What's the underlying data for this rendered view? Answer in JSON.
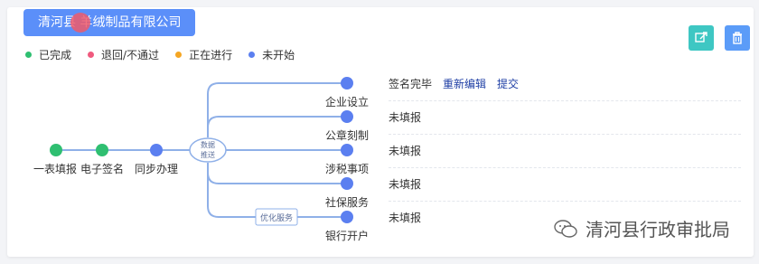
{
  "company": {
    "name": "清河县 羊绒制品有限公司"
  },
  "actions": {
    "share_icon": "share-icon",
    "delete_icon": "trash-icon"
  },
  "legend": [
    {
      "label": "已完成",
      "color": "#2fbf71"
    },
    {
      "label": "退回/不通过",
      "color": "#f05a7e"
    },
    {
      "label": "正在进行",
      "color": "#f5a623"
    },
    {
      "label": "未开始",
      "color": "#5b7ff0"
    }
  ],
  "main_steps": [
    {
      "label": "一表填报",
      "status": "完成"
    },
    {
      "label": "电子签名",
      "status": "完成"
    },
    {
      "label": "同步办理",
      "status": "未开始"
    }
  ],
  "hub": {
    "label_line1": "数据",
    "label_line2": "推送"
  },
  "optimize_tag": "优化服务",
  "branches": [
    {
      "label": "企业设立",
      "status_text": "签名完毕",
      "links": [
        "重新编辑",
        "提交"
      ]
    },
    {
      "label": "公章刻制",
      "status_text": "未填报",
      "links": []
    },
    {
      "label": "涉税事项",
      "status_text": "未填报",
      "links": []
    },
    {
      "label": "社保服务",
      "status_text": "未填报",
      "links": []
    },
    {
      "label": "银行开户",
      "status_text": "未填报",
      "links": []
    }
  ],
  "watermark": {
    "text": "清河县行政审批局"
  }
}
